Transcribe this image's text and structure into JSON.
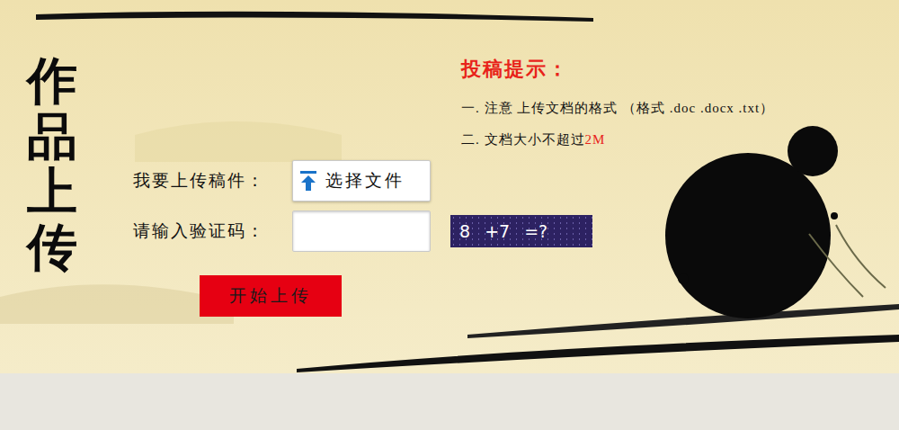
{
  "title": "作品上传",
  "form": {
    "file_label": "我要上传稿件：",
    "file_button": "选择文件",
    "captcha_label": "请输入验证码：",
    "captcha_value": "",
    "captcha_image": "8 +7 =?",
    "submit": "开始上传"
  },
  "tips": {
    "heading": "投稿提示：",
    "items": [
      {
        "parts": [
          {
            "text": "一. 注意 上传文档的格式 （格式 .doc .docx .txt）",
            "highlight": false
          }
        ]
      },
      {
        "parts": [
          {
            "text": "二. 文档大小不超过",
            "highlight": false
          },
          {
            "text": "2M",
            "highlight": true
          }
        ]
      }
    ]
  }
}
